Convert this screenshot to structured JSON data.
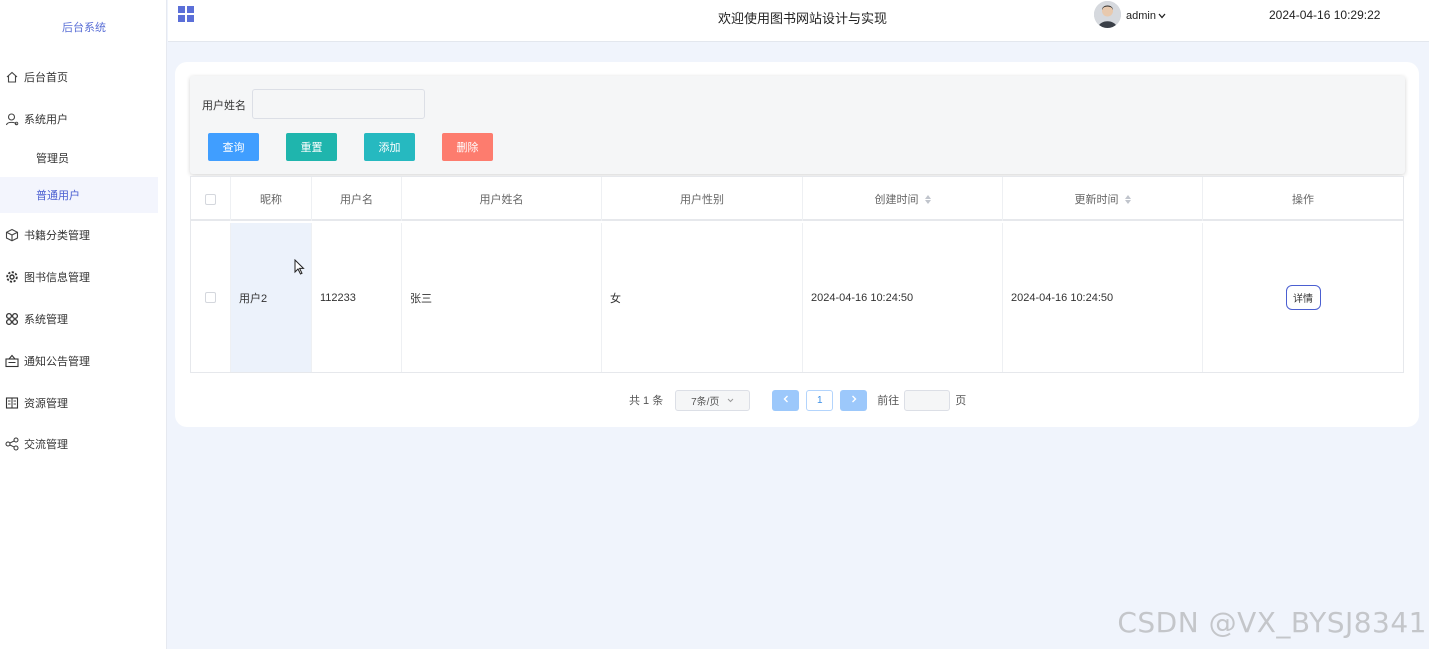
{
  "sidebar": {
    "logo": "后台系统",
    "items": [
      {
        "label": "后台首页",
        "icon": "home-icon"
      },
      {
        "label": "系统用户",
        "icon": "user-icon"
      },
      {
        "label": "书籍分类管理",
        "icon": "cube-icon"
      },
      {
        "label": "图书信息管理",
        "icon": "gear-icon"
      },
      {
        "label": "系统管理",
        "icon": "apps-icon"
      },
      {
        "label": "通知公告管理",
        "icon": "notice-icon"
      },
      {
        "label": "资源管理",
        "icon": "book-icon"
      },
      {
        "label": "交流管理",
        "icon": "share-icon"
      }
    ],
    "subitems": [
      {
        "label": "管理员"
      },
      {
        "label": "普通用户"
      }
    ]
  },
  "header": {
    "title": "欢迎使用图书网站设计与实现",
    "username": "admin",
    "datetime": "2024-04-16 10:29:22"
  },
  "search": {
    "label": "用户姓名",
    "placeholder": "",
    "buttons": {
      "query": "查询",
      "reset": "重置",
      "add": "添加",
      "delete": "删除"
    },
    "colors": {
      "query": "#409eff",
      "reset": "#1fb5ad",
      "add": "#26b9c0",
      "delete": "#fd7c6e"
    }
  },
  "table": {
    "columns": [
      "昵称",
      "用户名",
      "用户姓名",
      "用户性别",
      "创建时间",
      "更新时间",
      "操作"
    ],
    "rows": [
      {
        "nickname": "用户2",
        "username": "112233",
        "realname": "张三",
        "gender": "女",
        "created": "2024-04-16 10:24:50",
        "updated": "2024-04-16 10:24:50",
        "action": "详情"
      }
    ]
  },
  "pagination": {
    "total": "共 1 条",
    "page_size": "7条/页",
    "current_page": "1",
    "goto_label": "前往",
    "page_suffix": "页"
  },
  "watermark": "CSDN @VX_BYSJ8341"
}
